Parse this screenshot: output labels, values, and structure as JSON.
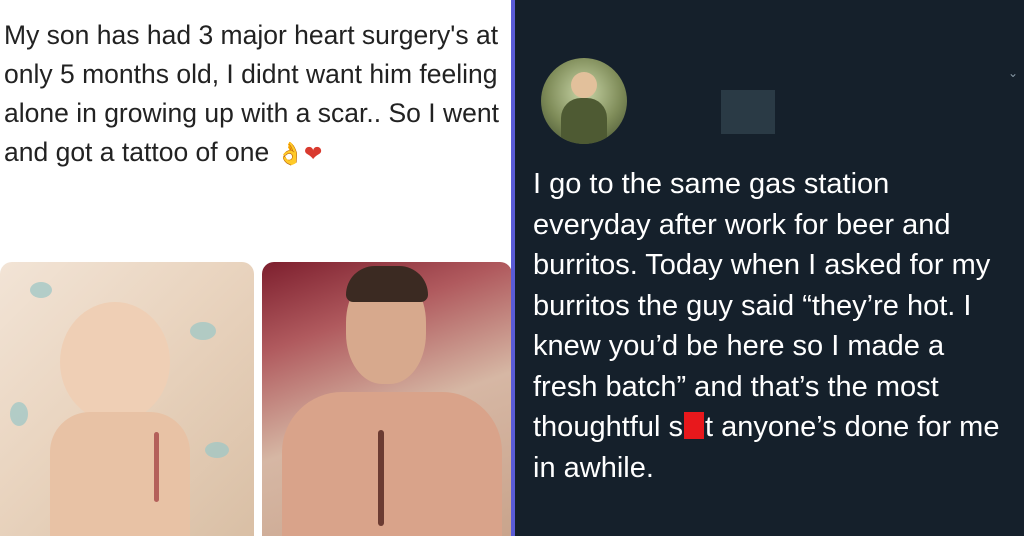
{
  "left_post": {
    "text": "My son has had 3 major heart surgery's at only 5 months old, I didnt want him feeling alone in growing up with a scar.. So I went and got a tattoo of one",
    "emoji_ok": "👌",
    "emoji_heart": "❤"
  },
  "right_post": {
    "tweet_before": "I go to the same gas station everyday after work for beer and burritos. Today when I asked for my burritos the guy said “they’re hot. I knew you’d be here so I made a fresh batch” and that’s the most thoughtful s",
    "tweet_after": "t anyone’s done for me in awhile."
  },
  "colors": {
    "divider": "#5a5bd6",
    "dark_bg": "#15202b",
    "censor_red": "#e8181c"
  }
}
